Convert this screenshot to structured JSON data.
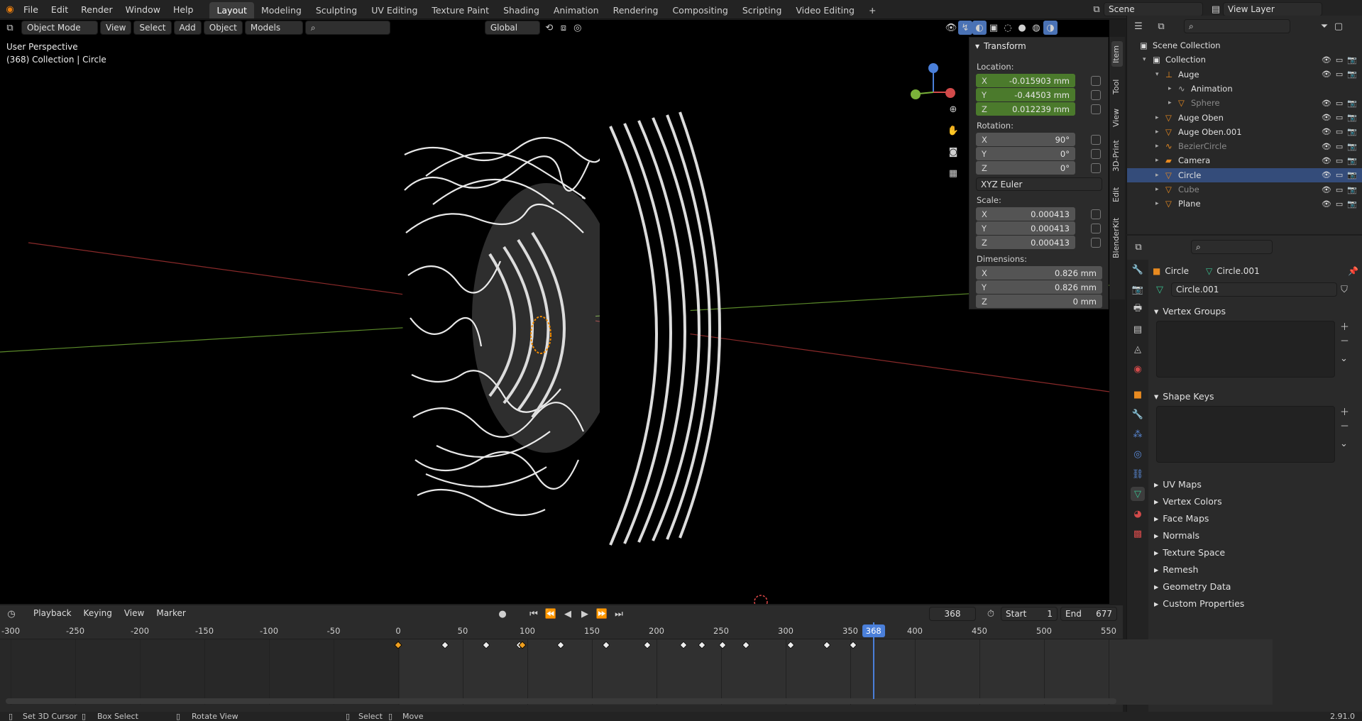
{
  "app": {
    "version": "2.91.0"
  },
  "topbar": {
    "menus": [
      "File",
      "Edit",
      "Render",
      "Window",
      "Help"
    ],
    "workspaces": [
      "Layout",
      "Modeling",
      "Sculpting",
      "UV Editing",
      "Texture Paint",
      "Shading",
      "Animation",
      "Rendering",
      "Compositing",
      "Scripting",
      "Video Editing"
    ],
    "active_workspace": "Layout",
    "add_tab": "+",
    "scene": "Scene",
    "view_layer": "View Layer"
  },
  "viewport_header": {
    "mode": "Object Mode",
    "menus": [
      "View",
      "Select",
      "Add",
      "Object"
    ],
    "collection_filter": "Models",
    "orientation": "Global"
  },
  "viewport": {
    "perspective": "User Perspective",
    "context": "(368) Collection | Circle"
  },
  "npanel": {
    "title": "Transform",
    "location_label": "Location:",
    "location": [
      {
        "axis": "X",
        "value": "-0.015903 mm"
      },
      {
        "axis": "Y",
        "value": "-0.44503 mm"
      },
      {
        "axis": "Z",
        "value": "0.012239 mm"
      }
    ],
    "rotation_label": "Rotation:",
    "rotation": [
      {
        "axis": "X",
        "value": "90°"
      },
      {
        "axis": "Y",
        "value": "0°"
      },
      {
        "axis": "Z",
        "value": "0°"
      }
    ],
    "rotation_mode": "XYZ Euler",
    "scale_label": "Scale:",
    "scale": [
      {
        "axis": "X",
        "value": "0.000413"
      },
      {
        "axis": "Y",
        "value": "0.000413"
      },
      {
        "axis": "Z",
        "value": "0.000413"
      }
    ],
    "dimensions_label": "Dimensions:",
    "dimensions": [
      {
        "axis": "X",
        "value": "0.826 mm"
      },
      {
        "axis": "Y",
        "value": "0.826 mm"
      },
      {
        "axis": "Z",
        "value": "0 mm"
      }
    ],
    "side_tabs": [
      "Item",
      "Tool",
      "View",
      "3D-Print",
      "Edit",
      "BlenderKit"
    ]
  },
  "outliner": {
    "rows": [
      {
        "label": "Scene Collection",
        "level": 0
      },
      {
        "label": "Collection",
        "level": 1
      },
      {
        "label": "Auge",
        "level": 2
      },
      {
        "label": "Animation",
        "level": 3
      },
      {
        "label": "Sphere",
        "level": 3
      },
      {
        "label": "Auge Oben",
        "level": 2
      },
      {
        "label": "Auge Oben.001",
        "level": 2
      },
      {
        "label": "BezierCircle",
        "level": 2
      },
      {
        "label": "Camera",
        "level": 2
      },
      {
        "label": "Circle",
        "level": 2
      },
      {
        "label": "Cube",
        "level": 2
      },
      {
        "label": "Plane",
        "level": 2
      }
    ]
  },
  "properties": {
    "object": "Circle",
    "mesh": "Circle.001",
    "data_name": "Circle.001",
    "panels_open": [
      "Vertex Groups",
      "Shape Keys"
    ],
    "panels_closed": [
      "UV Maps",
      "Vertex Colors",
      "Face Maps",
      "Normals",
      "Texture Space",
      "Remesh",
      "Geometry Data",
      "Custom Properties"
    ]
  },
  "timeline": {
    "menus": [
      "Playback",
      "Keying",
      "View",
      "Marker"
    ],
    "current_frame": "368",
    "start_label": "Start",
    "start": "1",
    "end_label": "End",
    "end": "677",
    "ruler": [
      "-300",
      "-250",
      "-200",
      "-150",
      "-100",
      "-50",
      "0",
      "50",
      "100",
      "150",
      "200",
      "250",
      "300",
      "350",
      "400",
      "450",
      "500",
      "550"
    ],
    "keyframes": [
      0,
      36,
      68,
      94,
      96,
      126,
      161,
      193,
      221,
      235,
      251,
      269,
      304,
      332,
      352
    ],
    "selected_keyframes": [
      0,
      96
    ]
  },
  "statusbar": {
    "items": [
      "Set 3D Cursor",
      "Box Select",
      "Rotate View",
      "Select",
      "Move"
    ]
  }
}
